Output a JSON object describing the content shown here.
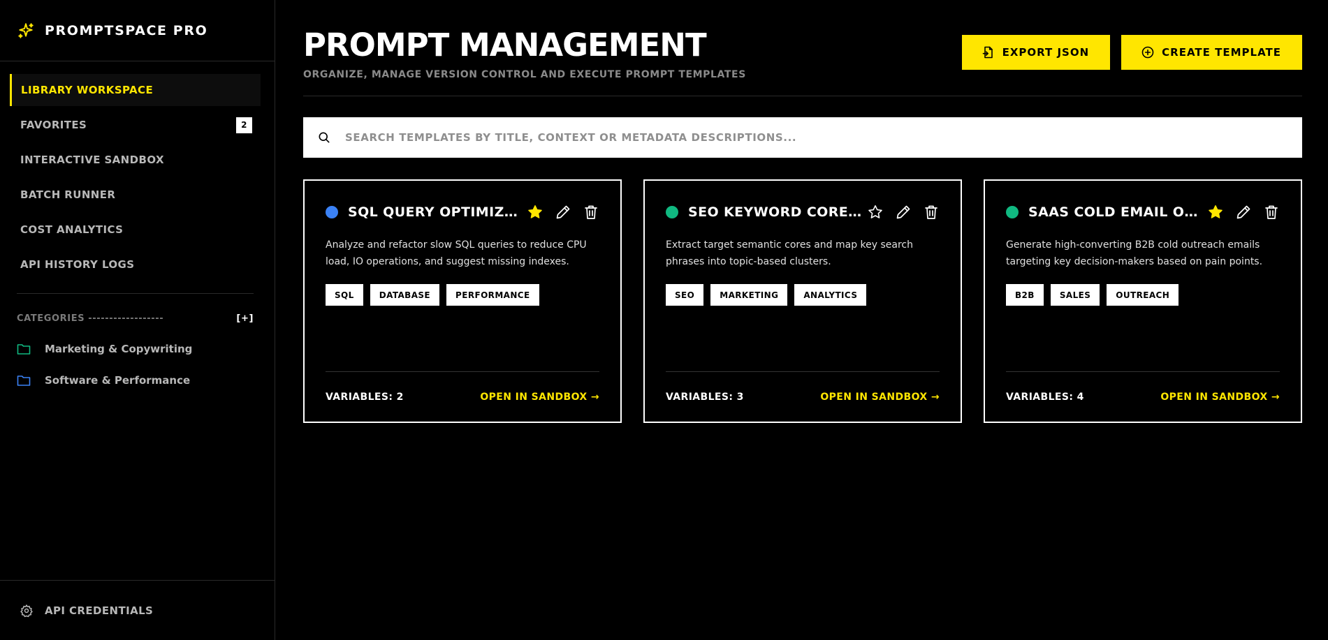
{
  "brand": {
    "name": "PROMPTSPACE PRO",
    "icon": "sparkle-icon",
    "accent": "#ffe600"
  },
  "nav": {
    "items": [
      {
        "label": "LIBRARY WORKSPACE",
        "active": true
      },
      {
        "label": "FAVORITES",
        "badge": "2"
      },
      {
        "label": "INTERACTIVE SANDBOX"
      },
      {
        "label": "BATCH RUNNER"
      },
      {
        "label": "COST ANALYTICS"
      },
      {
        "label": "API HISTORY LOGS"
      }
    ]
  },
  "categories": {
    "heading": "CATEGORIES ------------------",
    "add_label": "[+]",
    "items": [
      {
        "label": "Marketing & Copywriting",
        "color": "#10b981",
        "icon": "folder-icon"
      },
      {
        "label": "Software & Performance",
        "color": "#3b82f6",
        "icon": "folder-icon"
      }
    ]
  },
  "footer": {
    "label": "API CREDENTIALS",
    "icon": "gear-icon"
  },
  "header": {
    "title": "PROMPT MANAGEMENT",
    "subtitle": "ORGANIZE, MANAGE VERSION CONTROL AND EXECUTE PROMPT TEMPLATES",
    "export_label": "EXPORT JSON",
    "create_label": "CREATE TEMPLATE"
  },
  "search": {
    "placeholder": "SEARCH TEMPLATES BY TITLE, CONTEXT OR METADATA DESCRIPTIONS..."
  },
  "cards": [
    {
      "title": "SQL QUERY OPTIMIZER",
      "dot_color": "#3b82f6",
      "favorite": true,
      "description": "Analyze and refactor slow SQL queries to reduce CPU load, IO operations, and suggest missing indexes.",
      "tags": [
        "SQL",
        "DATABASE",
        "PERFORMANCE"
      ],
      "variables": "VARIABLES: 2",
      "open_label": "OPEN IN SANDBOX →"
    },
    {
      "title": "SEO KEYWORD CORE ...",
      "dot_color": "#10b981",
      "favorite": false,
      "description": "Extract target semantic cores and map key search phrases into topic-based clusters.",
      "tags": [
        "SEO",
        "MARKETING",
        "ANALYTICS"
      ],
      "variables": "VARIABLES: 3",
      "open_label": "OPEN IN SANDBOX →"
    },
    {
      "title": "SAAS COLD EMAIL OU...",
      "dot_color": "#10b981",
      "favorite": true,
      "description": "Generate high-converting B2B cold outreach emails targeting key decision-makers based on pain points.",
      "tags": [
        "B2B",
        "SALES",
        "OUTREACH"
      ],
      "variables": "VARIABLES: 4",
      "open_label": "OPEN IN SANDBOX →"
    }
  ]
}
